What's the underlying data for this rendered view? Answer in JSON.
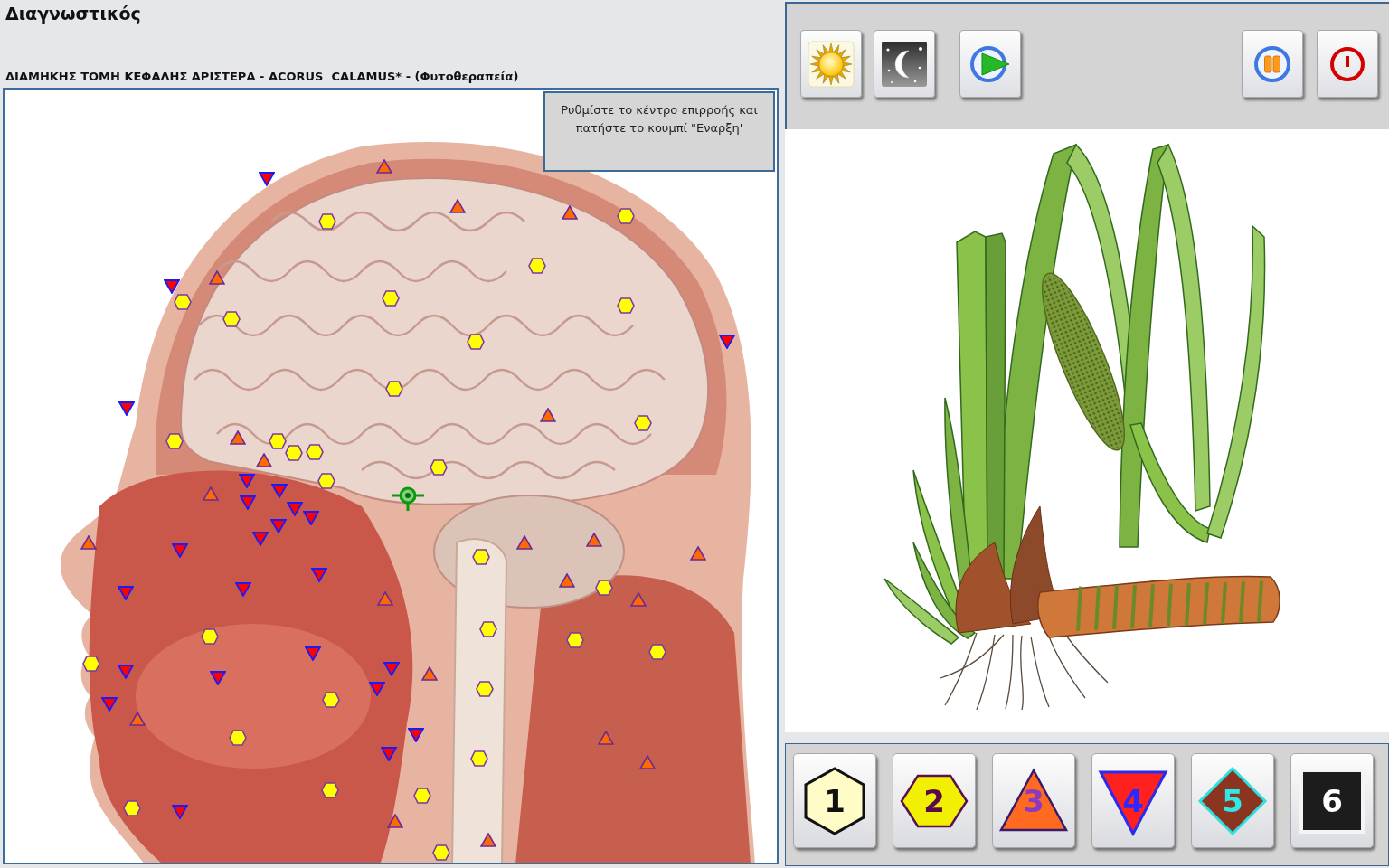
{
  "title": "Διαγνωστικός",
  "subtitle": "ΔΙΑΜΗΚΗΣ ΤΟΜΗ ΚΕΦΑΛΗΣ ΑΡΙΣΤΕΡΑ - ACORUS  CALAMUS* - (Φυτοθεραπεία)",
  "hint": "Ρυθμίστε το κέντρο επιρροής και πατήστε το κουμπί \"Εναρξη'",
  "markers": [
    {
      "kind": "hexagon"
    },
    {
      "kind": "hexagon"
    },
    {
      "kind": "hexagon"
    },
    {
      "kind": "hexagon"
    },
    {
      "kind": "hexagon"
    },
    {
      "kind": "hexagon"
    },
    {
      "kind": "hexagon"
    },
    {
      "kind": "hexagon"
    },
    {
      "kind": "hexagon"
    },
    {
      "kind": "hexagon"
    },
    {
      "kind": "hexagon"
    },
    {
      "kind": "hexagon"
    },
    {
      "kind": "hexagon"
    },
    {
      "kind": "hexagon"
    },
    {
      "kind": "hexagon"
    },
    {
      "kind": "hexagon"
    },
    {
      "kind": "hexagon"
    },
    {
      "kind": "hexagon"
    },
    {
      "kind": "hexagon"
    },
    {
      "kind": "hexagon"
    },
    {
      "kind": "hexagon"
    },
    {
      "kind": "hexagon"
    },
    {
      "kind": "hexagon"
    },
    {
      "kind": "hexagon"
    },
    {
      "kind": "hexagon"
    },
    {
      "kind": "hexagon"
    },
    {
      "kind": "hexagon"
    },
    {
      "kind": "hexagon"
    },
    {
      "kind": "hexagon"
    },
    {
      "kind": "hexagon"
    },
    {
      "kind": "hexagon"
    },
    {
      "kind": "triangle"
    },
    {
      "kind": "triangle"
    },
    {
      "kind": "triangle"
    },
    {
      "kind": "triangle"
    },
    {
      "kind": "triangle"
    },
    {
      "kind": "triangle"
    },
    {
      "kind": "triangle"
    },
    {
      "kind": "triangle"
    },
    {
      "kind": "triangle"
    },
    {
      "kind": "triangle"
    },
    {
      "kind": "triangle"
    },
    {
      "kind": "triangle"
    },
    {
      "kind": "triangle"
    },
    {
      "kind": "triangle"
    },
    {
      "kind": "triangle"
    },
    {
      "kind": "triangle"
    },
    {
      "kind": "triangle"
    },
    {
      "kind": "triangle"
    },
    {
      "kind": "triangle"
    },
    {
      "kind": "triangle"
    },
    {
      "kind": "triangle"
    },
    {
      "kind": "invtriangle"
    },
    {
      "kind": "invtriangle"
    },
    {
      "kind": "invtriangle"
    },
    {
      "kind": "invtriangle"
    },
    {
      "kind": "invtriangle"
    },
    {
      "kind": "invtriangle"
    },
    {
      "kind": "invtriangle"
    },
    {
      "kind": "invtriangle"
    },
    {
      "kind": "invtriangle"
    },
    {
      "kind": "invtriangle"
    },
    {
      "kind": "invtriangle"
    },
    {
      "kind": "invtriangle"
    },
    {
      "kind": "invtriangle"
    },
    {
      "kind": "invtriangle"
    },
    {
      "kind": "invtriangle"
    },
    {
      "kind": "invtriangle"
    },
    {
      "kind": "invtriangle"
    },
    {
      "kind": "invtriangle"
    },
    {
      "kind": "invtriangle"
    },
    {
      "kind": "invtriangle"
    },
    {
      "kind": "invtriangle"
    },
    {
      "kind": "invtriangle"
    },
    {
      "kind": "invtriangle"
    },
    {
      "kind": "invtriangle"
    }
  ],
  "level_buttons": [
    {
      "label": "1",
      "kind": "tallhex"
    },
    {
      "label": "2",
      "kind": "widehex"
    },
    {
      "label": "3",
      "kind": "triangle"
    },
    {
      "label": "4",
      "kind": "invtriangle"
    },
    {
      "label": "5",
      "kind": "diamond"
    },
    {
      "label": "6",
      "kind": "square"
    }
  ]
}
